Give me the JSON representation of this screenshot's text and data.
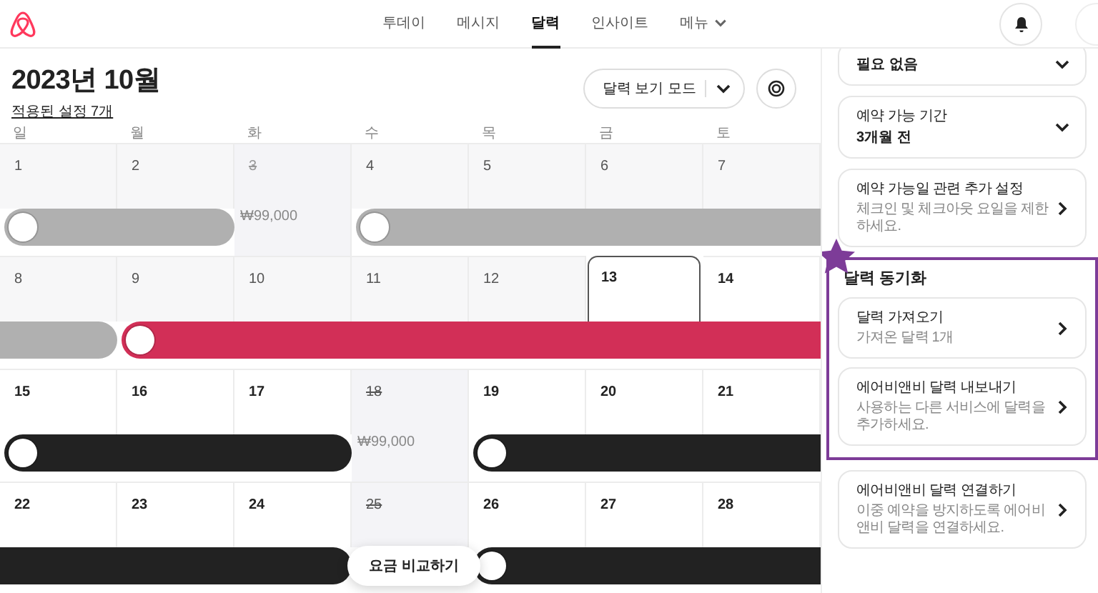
{
  "nav": {
    "tabs": [
      {
        "label": "투데이",
        "selected": false,
        "kind": "link"
      },
      {
        "label": "메시지",
        "selected": false,
        "kind": "link"
      },
      {
        "label": "달력",
        "selected": true,
        "kind": "link"
      },
      {
        "label": "인사이트",
        "selected": false,
        "kind": "link"
      },
      {
        "label": "메뉴",
        "selected": false,
        "kind": "dropdown"
      }
    ]
  },
  "calendar": {
    "title": "2023년 10월",
    "settings_link": "적용된 설정 7개",
    "view_mode_button": "달력 보기 모드",
    "weekdays": [
      "일",
      "월",
      "화",
      "수",
      "목",
      "금",
      "토"
    ],
    "weeks": [
      {
        "groups": [
          {
            "kind": "bar",
            "color": "#b0b0b0",
            "knob": true,
            "closed_end": true,
            "days": [
              {
                "date": "1",
                "past": true,
                "blocked": false,
                "today": false
              },
              {
                "date": "2",
                "past": true,
                "blocked": false,
                "today": false
              }
            ]
          },
          {
            "kind": "free",
            "days": [
              {
                "date": "3",
                "past": true,
                "blocked": true,
                "today": false,
                "price": "₩99,000"
              }
            ]
          },
          {
            "kind": "bar",
            "color": "#b0b0b0",
            "knob": true,
            "closed_end": false,
            "days": [
              {
                "date": "4",
                "past": true,
                "blocked": false,
                "today": false
              },
              {
                "date": "5",
                "past": true,
                "blocked": false,
                "today": false
              },
              {
                "date": "6",
                "past": true,
                "blocked": false,
                "today": false
              },
              {
                "date": "7",
                "past": true,
                "blocked": false,
                "today": false
              }
            ]
          }
        ]
      },
      {
        "groups": [
          {
            "kind": "bar",
            "color": "#b0b0b0",
            "knob": false,
            "closed_end": true,
            "days": [
              {
                "date": "8",
                "past": true,
                "blocked": false,
                "today": false
              }
            ]
          },
          {
            "kind": "bar",
            "color": "#d22f57",
            "knob": true,
            "closed_end": false,
            "days": [
              {
                "date": "9",
                "past": true,
                "blocked": false,
                "today": false
              },
              {
                "date": "10",
                "past": true,
                "blocked": false,
                "today": false
              },
              {
                "date": "11",
                "past": true,
                "blocked": false,
                "today": false
              },
              {
                "date": "12",
                "past": true,
                "blocked": false,
                "today": false
              },
              {
                "date": "13",
                "past": false,
                "blocked": false,
                "today": true
              },
              {
                "date": "14",
                "past": false,
                "blocked": false,
                "today": false
              }
            ]
          }
        ]
      },
      {
        "groups": [
          {
            "kind": "bar",
            "color": "#222222",
            "knob": true,
            "closed_end": true,
            "days": [
              {
                "date": "15",
                "past": false,
                "blocked": false,
                "today": false
              },
              {
                "date": "16",
                "past": false,
                "blocked": false,
                "today": false
              },
              {
                "date": "17",
                "past": false,
                "blocked": false,
                "today": false
              }
            ]
          },
          {
            "kind": "free",
            "days": [
              {
                "date": "18",
                "past": false,
                "blocked": true,
                "today": false,
                "price": "₩99,000"
              }
            ]
          },
          {
            "kind": "bar",
            "color": "#222222",
            "knob": true,
            "closed_end": false,
            "days": [
              {
                "date": "19",
                "past": false,
                "blocked": false,
                "today": false
              },
              {
                "date": "20",
                "past": false,
                "blocked": false,
                "today": false
              },
              {
                "date": "21",
                "past": false,
                "blocked": false,
                "today": false
              }
            ]
          }
        ]
      },
      {
        "groups": [
          {
            "kind": "bar",
            "color": "#222222",
            "knob": false,
            "closed_end": true,
            "days": [
              {
                "date": "22",
                "past": false,
                "blocked": false,
                "today": false
              },
              {
                "date": "23",
                "past": false,
                "blocked": false,
                "today": false
              },
              {
                "date": "24",
                "past": false,
                "blocked": false,
                "today": false
              }
            ]
          },
          {
            "kind": "free",
            "days": [
              {
                "date": "25",
                "past": false,
                "blocked": true,
                "today": false
              }
            ]
          },
          {
            "kind": "bar",
            "color": "#222222",
            "knob": true,
            "closed_end": false,
            "days": [
              {
                "date": "26",
                "past": false,
                "blocked": false,
                "today": false
              },
              {
                "date": "27",
                "past": false,
                "blocked": false,
                "today": false
              },
              {
                "date": "28",
                "past": false,
                "blocked": false,
                "today": false
              }
            ]
          }
        ]
      }
    ],
    "compare_button": "요금 비교하기"
  },
  "panel": {
    "cards": [
      {
        "value": "필요 없음",
        "kind": "dropdown"
      },
      {
        "title": "예약 가능 기간",
        "value": "3개월 전",
        "kind": "dropdown"
      },
      {
        "title": "예약 가능일 관련 추가 설정",
        "subtitle": "체크인 및 체크아웃 요일을 제한하세요.",
        "kind": "link"
      }
    ],
    "sync": {
      "title": "달력 동기화",
      "highlighted": true,
      "cards": [
        {
          "title": "달력 가져오기",
          "subtitle": "가져온 달력 1개",
          "kind": "link"
        },
        {
          "title": "에어비앤비 달력 내보내기",
          "subtitle": "사용하는 다른 서비스에 달력을 추가하세요.",
          "kind": "link"
        }
      ]
    },
    "more_cards": [
      {
        "title": "에어비앤비 달력 연결하기",
        "subtitle": "이중 예약을 방지하도록 에어비앤비 달력을 연결하세요.",
        "kind": "link"
      }
    ]
  }
}
